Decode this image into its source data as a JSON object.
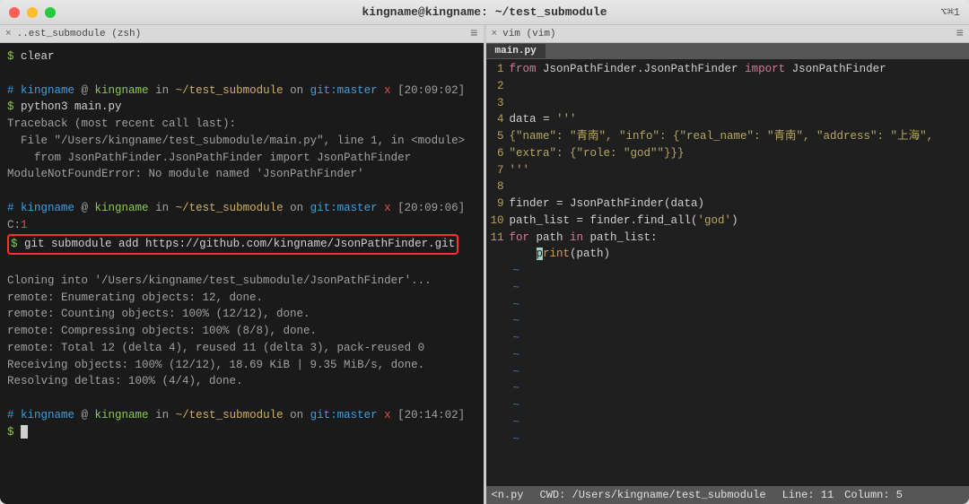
{
  "window": {
    "title": "kingname@kingname: ~/test_submodule",
    "shortcut": "⌥⌘1"
  },
  "panes": {
    "left": {
      "tab_label": "..est_submodule (zsh)",
      "lines": {
        "ps": "$",
        "cmd_clear": "clear",
        "prompt1_user": "kingname",
        "prompt1_at": " @ ",
        "prompt1_host": "kingname",
        "prompt1_in": " in ",
        "prompt1_dir": "~/test_submodule",
        "prompt1_on": " on ",
        "prompt1_git": "git:",
        "prompt1_branch": "master",
        "prompt1_x": " x ",
        "prompt1_time": "[20:09:02]",
        "cmd_python": "python3 main.py",
        "traceback": "Traceback (most recent call last):",
        "file_line": "  File \"/Users/kingname/test_submodule/main.py\", line 1, in <module>",
        "import_line": "    from JsonPathFinder.JsonPathFinder import JsonPathFinder",
        "error_line": "ModuleNotFoundError: No module named 'JsonPathFinder'",
        "prompt2_time": "[20:09:06]",
        "prompt2_c1": " C:",
        "prompt2_c1_num": "1",
        "cmd_git": "git submodule add https://github.com/kingname/JsonPathFinder.git",
        "cloning": "Cloning into '/Users/kingname/test_submodule/JsonPathFinder'...",
        "remote1": "remote: Enumerating objects: 12, done.",
        "remote2": "remote: Counting objects: 100% (12/12), done.",
        "remote3": "remote: Compressing objects: 100% (8/8), done.",
        "remote4": "remote: Total 12 (delta 4), reused 11 (delta 3), pack-reused 0",
        "receiving": "Receiving objects: 100% (12/12), 18.69 KiB | 9.35 MiB/s, done.",
        "resolving": "Resolving deltas: 100% (4/4), done.",
        "prompt3_time": "[20:14:02]"
      }
    },
    "right": {
      "tab_label": "vim (vim)",
      "file_tab": "main.py",
      "gutter": [
        "1",
        "2",
        "3",
        "4",
        "5",
        "6",
        "7",
        "8",
        "9",
        "10",
        "11"
      ],
      "code": {
        "l1_from": "from",
        "l1_mod": " JsonPathFinder.JsonPathFinder ",
        "l1_import": "import",
        "l1_name": " JsonPathFinder",
        "l4": "data = ",
        "l4_str": "'''",
        "l5": "{\"name\": \"青南\", \"info\": {\"real_name\": \"青南\", \"address\": \"上海\", \"extra\": {\"role: \"god\"\"}}}",
        "l6": "'''",
        "l8": "finder = JsonPathFinder(data)",
        "l9a": "path_list = finder.find_all(",
        "l9b": "'god'",
        "l9c": ")",
        "l10_for": "for",
        "l10_mid": " path ",
        "l10_in": "in",
        "l10_end": " path_list:",
        "l11_indent": "    ",
        "l11_p": "p",
        "l11_rint": "rint",
        "l11_paren": "(path)"
      },
      "status": {
        "fname": "<n.py",
        "cwd": "CWD:  /Users/kingname/test_submodule",
        "line": "Line:  11",
        "col": "Column:  5"
      }
    }
  }
}
